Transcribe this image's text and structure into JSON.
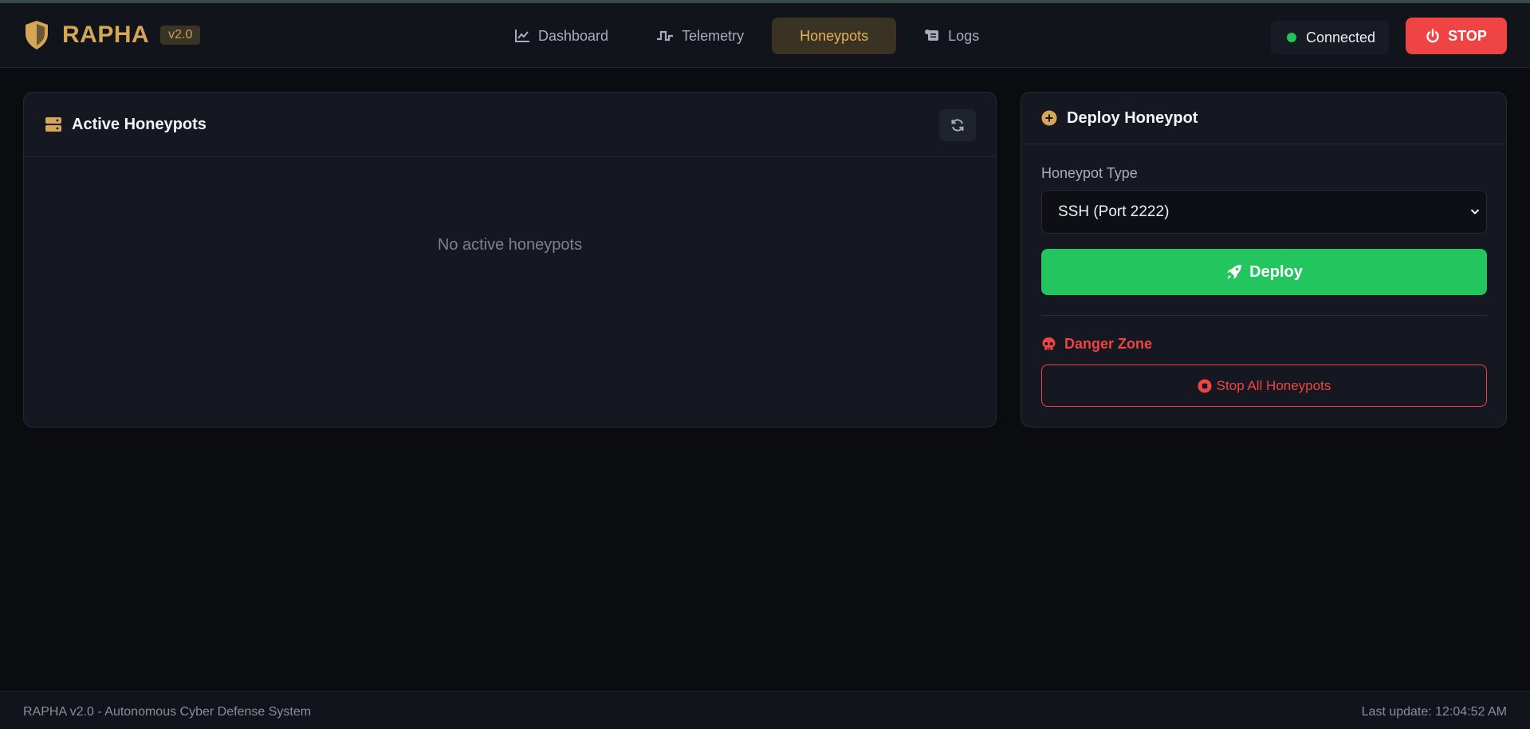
{
  "brand": {
    "name": "RAPHA",
    "version": "v2.0",
    "shield_icon": "shield-icon",
    "color": "#d4a655"
  },
  "nav": {
    "items": [
      {
        "label": "Dashboard",
        "icon": "line-chart-icon",
        "active": false
      },
      {
        "label": "Telemetry",
        "icon": "pulse-icon",
        "active": false
      },
      {
        "label": "Honeypots",
        "icon": "honeypot-icon",
        "active": true
      },
      {
        "label": "Logs",
        "icon": "scroll-icon",
        "active": false
      }
    ]
  },
  "status": {
    "label": "Connected",
    "color": "#27c25c"
  },
  "stop_button": {
    "label": "STOP",
    "icon": "power-icon",
    "color": "#ef4444"
  },
  "active_card": {
    "title": "Active Honeypots",
    "icon": "server-icon",
    "refresh_icon": "refresh-icon",
    "empty_text": "No active honeypots"
  },
  "deploy_card": {
    "title": "Deploy Honeypot",
    "icon": "plus-circle-icon",
    "type_label": "Honeypot Type",
    "selected_type": "SSH (Port 2222)",
    "deploy_label": "Deploy",
    "deploy_icon": "rocket-icon",
    "deploy_color": "#22c55e",
    "danger_title": "Danger Zone",
    "danger_icon": "skull-icon",
    "stop_all_label": "Stop All Honeypots",
    "stop_all_icon": "stop-circle-icon"
  },
  "footer": {
    "left": "RAPHA v2.0 - Autonomous Cyber Defense System",
    "right": "Last update: 12:04:52 AM"
  }
}
